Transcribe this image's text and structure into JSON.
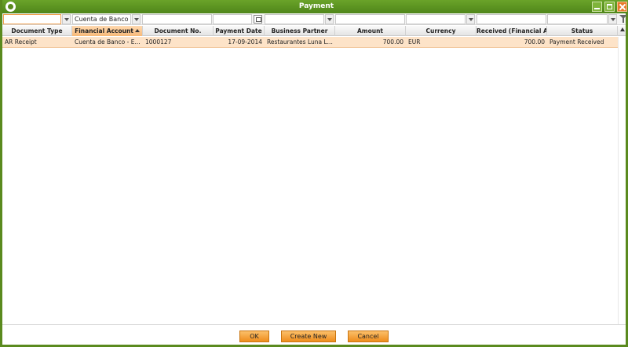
{
  "window": {
    "title": "Payment"
  },
  "filters": {
    "financial_account": "Cuenta de Banco - E"
  },
  "columns": [
    "Document Type",
    "Financial Account",
    "Document No.",
    "Payment Date",
    "Business Partner",
    "Amount",
    "Currency",
    "Received (Financial Ac...",
    "Status"
  ],
  "sort": {
    "column": "Financial Account",
    "direction": "ascending"
  },
  "rows": [
    {
      "document_type": "AR Receipt",
      "financial_account": "Cuenta de Banco - E...",
      "document_no": "1000127",
      "payment_date": "17-09-2014",
      "business_partner": "Restaurantes Luna L...",
      "amount": "700.00",
      "currency": "EUR",
      "received": "700.00",
      "status": "Payment Received"
    }
  ],
  "buttons": {
    "ok": "OK",
    "create_new": "Create New",
    "cancel": "Cancel"
  },
  "colors": {
    "title_bar": "#5a8a1e",
    "selected_row": "#fde3c8",
    "button": "#ef8d1c"
  }
}
